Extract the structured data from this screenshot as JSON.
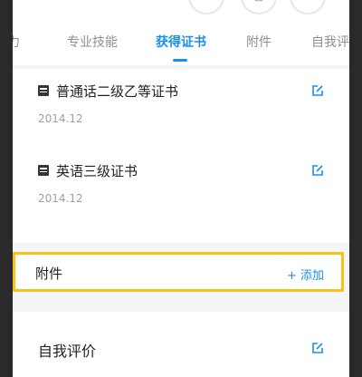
{
  "top_buttons": [
    {
      "glyph": "·"
    },
    {
      "glyph": "□"
    },
    {
      "glyph": ""
    }
  ],
  "tabs": [
    {
      "label": "力"
    },
    {
      "label": "专业技能"
    },
    {
      "label": "获得证书",
      "active": true
    },
    {
      "label": "附件"
    },
    {
      "label": "自我评"
    }
  ],
  "certificates": [
    {
      "title": "普通话二级乙等证书",
      "date": "2014.12"
    },
    {
      "title": "英语三级证书",
      "date": "2014.12"
    }
  ],
  "attachment": {
    "label": "附件",
    "add_label": "+ 添加"
  },
  "self_evaluation": {
    "label": "自我评价"
  },
  "colors": {
    "accent": "#1a8df0",
    "highlight": "#f7c21a"
  }
}
